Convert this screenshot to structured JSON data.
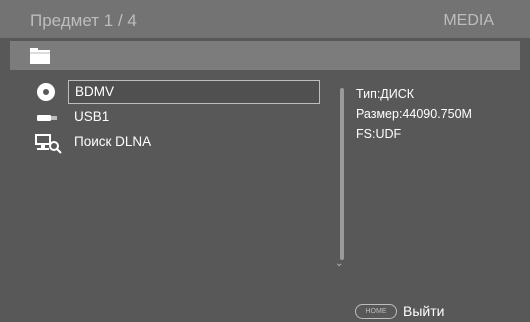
{
  "header": {
    "title": "Предмет 1 / 4",
    "brand": "MEDIA"
  },
  "list": {
    "items": [
      {
        "label": "BDMV",
        "icon": "disc-icon",
        "selected": true
      },
      {
        "label": "USB1",
        "icon": "usb-icon",
        "selected": false
      },
      {
        "label": "Поиск DLNA",
        "icon": "network-search-icon",
        "selected": false
      }
    ]
  },
  "info": {
    "type": "Тип:ДИСК",
    "size": "Размер:44090.750M",
    "fs": "FS:UDF"
  },
  "footer": {
    "home_label": "HOME",
    "exit_label": "Выйти"
  },
  "colors": {
    "background": "#585858",
    "header_bar": "#737373",
    "path_bar": "#7c7c7c",
    "text": "#ffffff",
    "muted_text": "#bdbdbd"
  }
}
